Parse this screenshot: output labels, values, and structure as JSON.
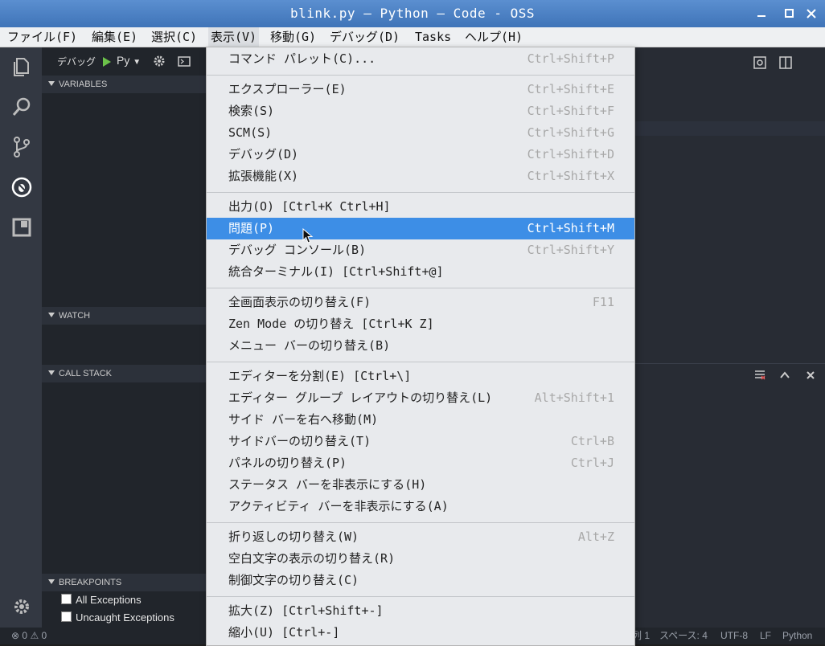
{
  "window": {
    "title": "blink.py — Python — Code - OSS"
  },
  "menubar": [
    "ファイル(F)",
    "編集(E)",
    "選択(C)",
    "表示(V)",
    "移動(G)",
    "デバッグ(D)",
    "Tasks",
    "ヘルプ(H)"
  ],
  "debug_toolbar": {
    "label": "デバッグ",
    "config": "Py"
  },
  "sidebar": {
    "variables": "VARIABLES",
    "watch": "WATCH",
    "call_stack": "CALL STACK",
    "breakpoints": "BREAKPOINTS",
    "bp_items": [
      "All Exceptions",
      "Uncaught Exceptions"
    ]
  },
  "view_menu": {
    "groups": [
      [
        {
          "label": "コマンド パレット(C)...",
          "key": "Ctrl+Shift+P"
        }
      ],
      [
        {
          "label": "エクスプローラー(E)",
          "key": "Ctrl+Shift+E"
        },
        {
          "label": "検索(S)",
          "key": "Ctrl+Shift+F"
        },
        {
          "label": "SCM(S)",
          "key": "Ctrl+Shift+G"
        },
        {
          "label": "デバッグ(D)",
          "key": "Ctrl+Shift+D"
        },
        {
          "label": "拡張機能(X)",
          "key": "Ctrl+Shift+X"
        }
      ],
      [
        {
          "label": "出力(O) [Ctrl+K Ctrl+H]",
          "key": ""
        },
        {
          "label": "問題(P)",
          "key": "Ctrl+Shift+M",
          "highlighted": true
        },
        {
          "label": "デバッグ コンソール(B)",
          "key": "Ctrl+Shift+Y"
        },
        {
          "label": "統合ターミナル(I) [Ctrl+Shift+@]",
          "key": ""
        }
      ],
      [
        {
          "label": "全画面表示の切り替え(F)",
          "key": "F11"
        },
        {
          "label": "Zen Mode の切り替え [Ctrl+K Z]",
          "key": ""
        },
        {
          "label": "メニュー バーの切り替え(B)",
          "key": ""
        }
      ],
      [
        {
          "label": "エディターを分割(E) [Ctrl+\\]",
          "key": ""
        },
        {
          "label": "エディター グループ レイアウトの切り替え(L)",
          "key": "Alt+Shift+1"
        },
        {
          "label": "サイド バーを右へ移動(M)",
          "key": ""
        },
        {
          "label": "サイドバーの切り替え(T)",
          "key": "Ctrl+B"
        },
        {
          "label": "パネルの切り替え(P)",
          "key": "Ctrl+J"
        },
        {
          "label": "ステータス バーを非表示にする(H)",
          "key": ""
        },
        {
          "label": "アクティビティ バーを非表示にする(A)",
          "key": ""
        }
      ],
      [
        {
          "label": "折り返しの切り替え(W)",
          "key": "Alt+Z"
        },
        {
          "label": "空白文字の表示の切り替え(R)",
          "key": ""
        },
        {
          "label": "制御文字の切り替え(C)",
          "key": ""
        }
      ],
      [
        {
          "label": "拡大(Z) [Ctrl+Shift+-]",
          "key": ""
        },
        {
          "label": "縮小(U) [Ctrl+-]",
          "key": ""
        }
      ]
    ]
  },
  "statusbar": {
    "errors": "0",
    "warnings": "0",
    "col": "列 1",
    "spaces": "スペース: 4",
    "encoding": "UTF-8",
    "eol": "LF",
    "language": "Python"
  },
  "colors": {
    "accent": "#3d8ee6",
    "titlebar": "#4a7fc1"
  }
}
